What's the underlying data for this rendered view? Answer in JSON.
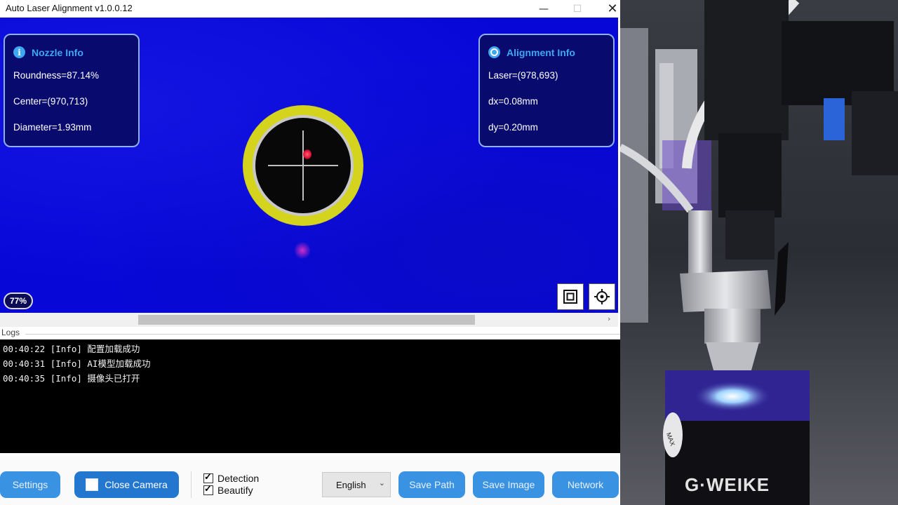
{
  "window": {
    "title": "Auto Laser Alignment v1.0.0.12",
    "minimize_glyph": "—",
    "maximize_glyph": "☐",
    "close_glyph": "✕"
  },
  "nozzle_info": {
    "title": "Nozzle Info",
    "icon": "info-icon",
    "icon_glyph": "i",
    "roundness": "Roundness=87.14%",
    "center": "Center=(970,713)",
    "diameter": "Diameter=1.93mm"
  },
  "alignment_info": {
    "title": "Alignment Info",
    "icon": "target-icon",
    "laser": "Laser=(978,693)",
    "dx": "dx=0.08mm",
    "dy": "dy=0.20mm"
  },
  "camera": {
    "zoom": "77%",
    "background_color": "#0707d8",
    "ring_color": "#d4d41e",
    "tools": [
      "fit-view-icon",
      "target-icon"
    ]
  },
  "logs": {
    "label": "Logs",
    "lines": [
      "00:40:22 [Info] 配置加载成功",
      "00:40:31 [Info] AI模型加载成功",
      "00:40:35 [Info] 摄像头已打开"
    ]
  },
  "toolbar": {
    "settings_label": "Settings",
    "close_camera_label": "Close Camera",
    "detection_label": "Detection",
    "beautify_label": "Beautify",
    "detection_checked": true,
    "beautify_checked": true,
    "language_value": "English",
    "save_path_label": "Save Path",
    "save_image_label": "Save Image",
    "network_label": "Network",
    "accent_color": "#2f87d8"
  },
  "photo": {
    "brand": "G·WEIKE",
    "tag": "MAX"
  }
}
